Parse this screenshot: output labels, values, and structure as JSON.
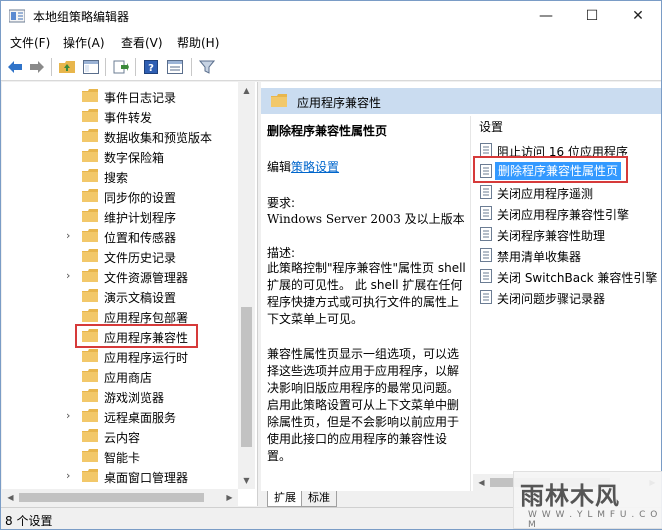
{
  "window": {
    "title": "本地组策略编辑器",
    "minimize": "—",
    "maximize": "☐",
    "close": "✕"
  },
  "menu": [
    {
      "label": "文件(F)"
    },
    {
      "label": "操作(A)"
    },
    {
      "label": "查看(V)"
    },
    {
      "label": "帮助(H)"
    }
  ],
  "toolbar": {
    "icons": [
      "back-arrow-icon",
      "forward-arrow-icon",
      "up-folder-icon",
      "show-hide-tree-icon",
      "export-list-icon",
      "help-icon",
      "properties-icon",
      "filter-icon"
    ]
  },
  "tree": {
    "items": [
      {
        "label": "事件日志记录",
        "expandable": false
      },
      {
        "label": "事件转发",
        "expandable": false
      },
      {
        "label": "数据收集和预览版本",
        "expandable": false
      },
      {
        "label": "数字保险箱",
        "expandable": false
      },
      {
        "label": "搜索",
        "expandable": false
      },
      {
        "label": "同步你的设置",
        "expandable": false
      },
      {
        "label": "维护计划程序",
        "expandable": false
      },
      {
        "label": "位置和传感器",
        "expandable": true
      },
      {
        "label": "文件历史记录",
        "expandable": false
      },
      {
        "label": "文件资源管理器",
        "expandable": true
      },
      {
        "label": "演示文稿设置",
        "expandable": false
      },
      {
        "label": "应用程序包部署",
        "expandable": false
      },
      {
        "label": "应用程序兼容性",
        "expandable": false,
        "selected": true
      },
      {
        "label": "应用程序运行时",
        "expandable": false
      },
      {
        "label": "应用商店",
        "expandable": false
      },
      {
        "label": "游戏浏览器",
        "expandable": false
      },
      {
        "label": "远程桌面服务",
        "expandable": true
      },
      {
        "label": "云内容",
        "expandable": false
      },
      {
        "label": "智能卡",
        "expandable": false
      },
      {
        "label": "桌面窗口管理器",
        "expandable": true
      }
    ]
  },
  "right": {
    "header": "应用程序兼容性",
    "description": {
      "title": "删除程序兼容性属性页",
      "edit_prefix": "编辑",
      "edit_link": "策略设置",
      "requirements_label": "要求:",
      "requirements_value": "Windows Server 2003 及以上版本",
      "desc_label": "描述:",
      "paragraph1": "此策略控制\"程序兼容性\"属性页 shell 扩展的可见性。 此 shell 扩展在任何程序快捷方式或可执行文件的属性上下文菜单上可见。",
      "paragraph2": "兼容性属性页显示一组选项，可以选择这些选项并应用于应用程序，以解决影响旧版应用程序的最常见问题。启用此策略设置可从上下文菜单中删除属性页，但是不会影响以前应用于使用此接口的应用程序的兼容性设置。"
    },
    "settings_header": "设置",
    "settings": [
      {
        "label": "阻止访问 16 位应用程序"
      },
      {
        "label": "删除程序兼容性属性页",
        "selected": true
      },
      {
        "label": "关闭应用程序遥测"
      },
      {
        "label": "关闭应用程序兼容性引擎"
      },
      {
        "label": "关闭程序兼容性助理"
      },
      {
        "label": "禁用清单收集器"
      },
      {
        "label": "关闭 SwitchBack 兼容性引擎"
      },
      {
        "label": "关闭问题步骤记录器"
      }
    ],
    "tabs": [
      {
        "label": "扩展"
      },
      {
        "label": "标准"
      }
    ]
  },
  "status": {
    "text": "8 个设置"
  },
  "watermark": {
    "logo": "雨林木风",
    "url": "W W W . Y L M F U . C O M"
  },
  "colors": {
    "selection": "#3399ff",
    "highlight_box": "#d63a3a",
    "header_band": "#cadcf0",
    "link": "#0066cc",
    "folder": "#e8b64c"
  }
}
